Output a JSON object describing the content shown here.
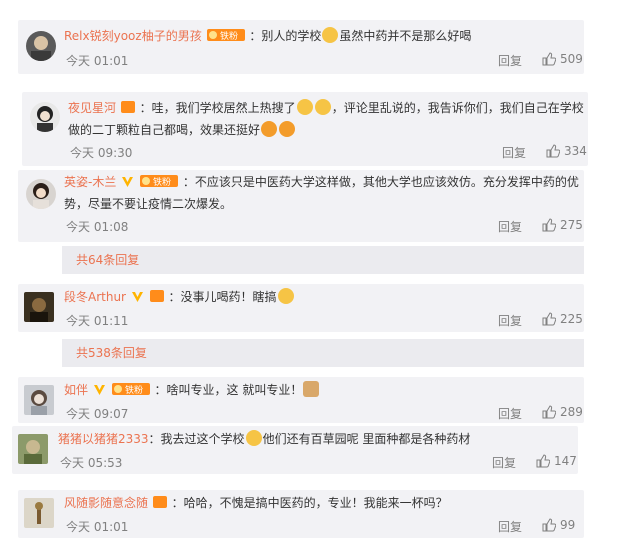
{
  "comments": [
    {
      "user": "Relx锐刻yooz柚子的男孩",
      "text_a": "：别人的学校",
      "text_b": "虽然中药并不是那么好喝",
      "text_c": "",
      "time": "今天 01:01",
      "reply": "回复",
      "likes": "509",
      "badge": "铁粉"
    },
    {
      "user": "夜见星河",
      "text_a": "：哇，我们学校居然上热搜了",
      "text_b": "，评论里乱说的，我告诉你们，我们自己在学校",
      "text_c": "做的二丁颗粒自己都喝，效果还挺好",
      "time": "今天 09:30",
      "reply": "回复",
      "likes": "334"
    },
    {
      "user": "英姿-木兰",
      "text_a": "：不应该只是中医药大学这样做，其他大学也应该效仿。充分发挥中药的优",
      "text_b": "势，尽量不要让疫情二次爆发。",
      "text_c": "",
      "time": "今天 01:08",
      "reply": "回复",
      "likes": "275",
      "badge": "铁粉"
    },
    {
      "user": "段冬Arthur",
      "text_a": "：没事儿喝药！瞎搞",
      "text_b": "",
      "text_c": "",
      "time": "今天 01:11",
      "reply": "回复",
      "likes": "225"
    },
    {
      "user": "如伴",
      "text_a": "：啥叫专业，这 就叫专业！",
      "text_b": "",
      "text_c": "",
      "time": "今天 09:07",
      "reply": "回复",
      "likes": "289",
      "badge": "铁粉"
    },
    {
      "user": "猪猪以猪猪2333",
      "text_a": "：我去过这个学校",
      "text_b": "他们还有百草园呢 里面种都是各种药材",
      "text_c": "",
      "time": "今天 05:53",
      "reply": "回复",
      "likes": "147"
    },
    {
      "user": "风随影随意念随",
      "text_a": "：哈哈，不愧是搞中医药的，专业！我能来一杯吗？",
      "text_b": "",
      "text_c": "",
      "time": "今天 01:01",
      "reply": "回复",
      "likes": "99"
    }
  ],
  "more": [
    {
      "label": "共64条回复"
    },
    {
      "label": "共538条回复"
    }
  ],
  "colors": {
    "name": "#eb7350",
    "card": "#f2f2f5",
    "vip": "#ffb400"
  }
}
